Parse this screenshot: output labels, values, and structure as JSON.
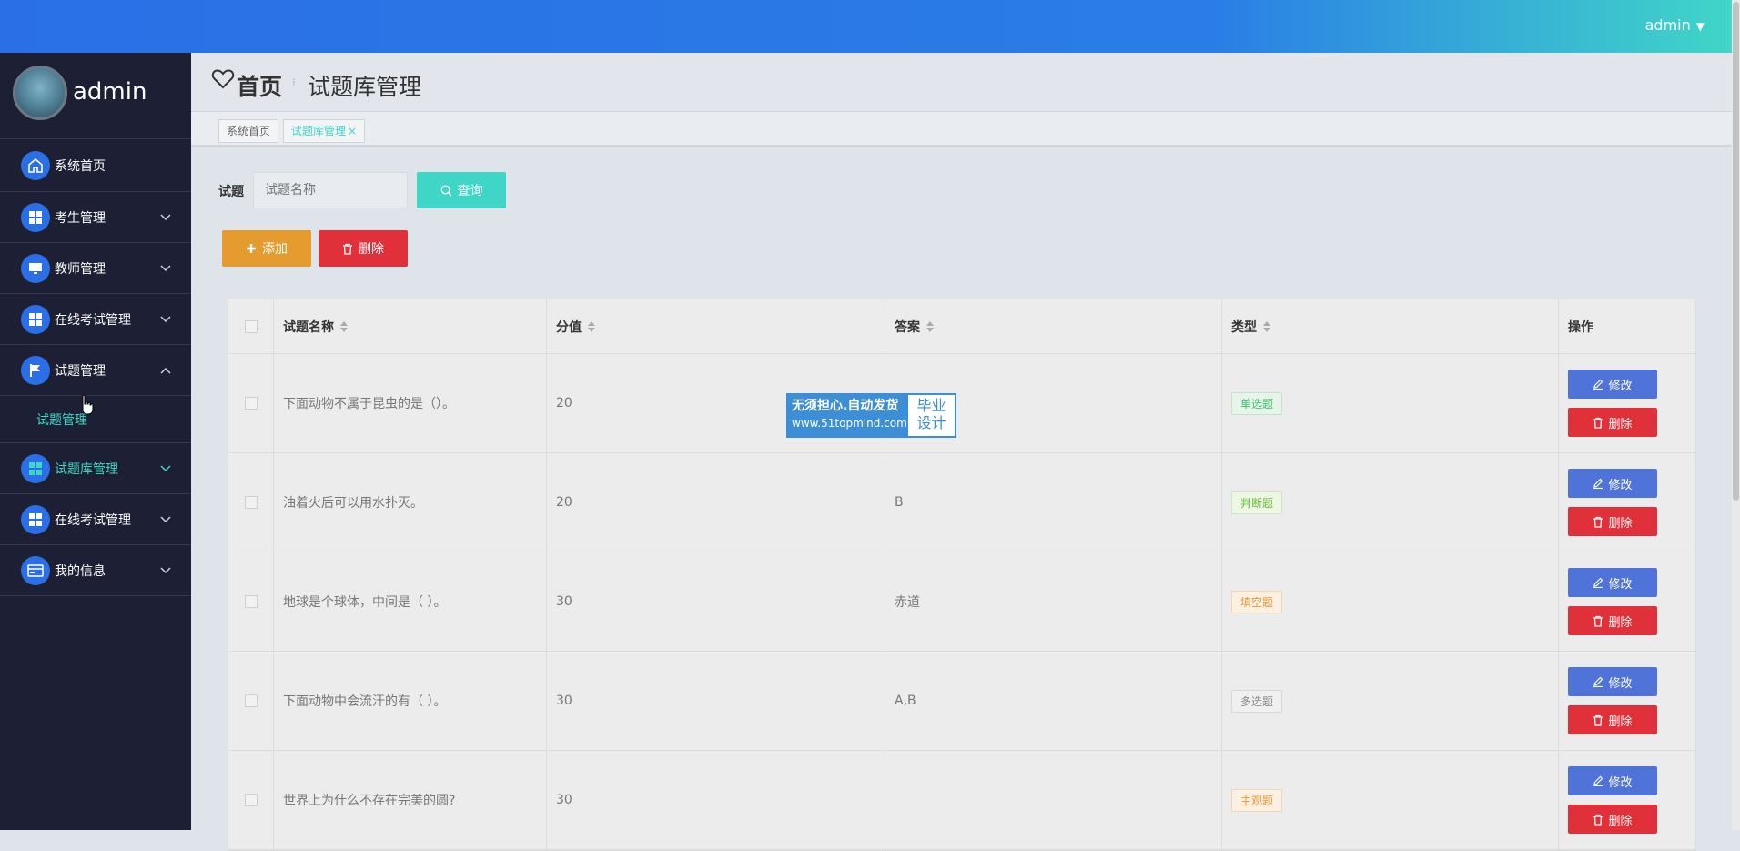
{
  "header": {
    "user": "admin"
  },
  "sidebar": {
    "username": "admin",
    "items": [
      {
        "label": "系统首页"
      },
      {
        "label": "考生管理"
      },
      {
        "label": "教师管理"
      },
      {
        "label": "在线考试管理"
      },
      {
        "label": "试题管理"
      },
      {
        "label": "试题库管理"
      },
      {
        "label": "在线考试管理"
      },
      {
        "label": "我的信息"
      }
    ],
    "submenu": {
      "label": "试题管理"
    }
  },
  "breadcrumb": {
    "home": "首页",
    "page": "试题库管理"
  },
  "tabs": [
    {
      "label": "系统首页"
    },
    {
      "label": "试题库管理"
    }
  ],
  "search": {
    "label": "试题",
    "placeholder": "试题名称",
    "query_button": "查询"
  },
  "actions": {
    "add": "添加",
    "delete": "删除"
  },
  "table": {
    "columns": [
      "试题名称",
      "分值",
      "答案",
      "类型",
      "操作"
    ],
    "edit_label": "修改",
    "delete_label": "删除",
    "rows": [
      {
        "name": "下面动物不属于昆虫的是（）。",
        "score": "20",
        "answer": "",
        "type": "单选题"
      },
      {
        "name": "油着火后可以用水扑灭。",
        "score": "20",
        "answer": "B",
        "type": "判断题"
      },
      {
        "name": "地球是个球体，中间是（ ）。",
        "score": "30",
        "answer": "赤道",
        "type": "填空题"
      },
      {
        "name": "下面动物中会流汗的有（ ）。",
        "score": "30",
        "answer": "A,B",
        "type": "多选题"
      },
      {
        "name": "世界上为什么不存在完美的圆?",
        "score": "30",
        "answer": "",
        "type": "主观题"
      }
    ]
  },
  "watermark": {
    "line1": "无须担心.自动发货",
    "line2": "www.51topmind.com",
    "right1": "毕业",
    "right2": "设计"
  },
  "colors": {
    "primary": "#2a6fe6",
    "accent": "#3fd6c7",
    "warning": "#e69b2f",
    "danger": "#e0313a",
    "edit": "#4f73d9",
    "sidebar": "#1d2034"
  }
}
